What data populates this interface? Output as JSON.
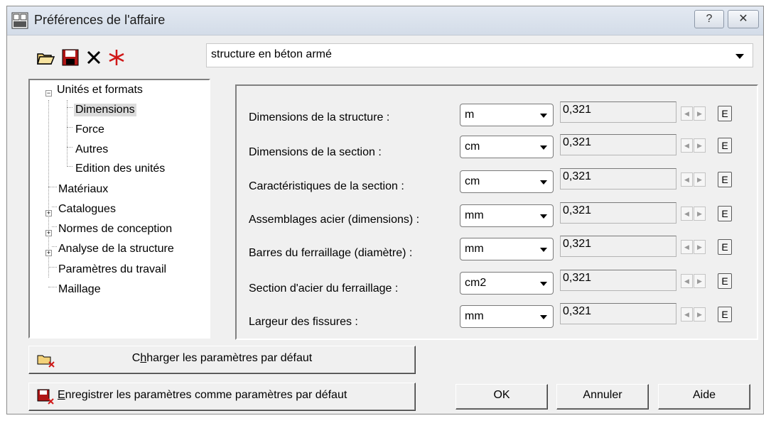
{
  "window": {
    "title": "Préférences de l'affaire",
    "help_label": "?",
    "close_label": "✕"
  },
  "toolbar": {
    "icons": [
      "open-folder-icon",
      "save-disk-icon",
      "delete-x-icon",
      "new-star-icon"
    ]
  },
  "profile_combo": {
    "value": "structure en béton armé"
  },
  "tree": {
    "items": [
      {
        "label": "Unités et formats",
        "level": 0,
        "expander": "−"
      },
      {
        "label": "Dimensions",
        "level": 1,
        "selected": true
      },
      {
        "label": "Force",
        "level": 1
      },
      {
        "label": "Autres",
        "level": 1
      },
      {
        "label": "Edition des unités",
        "level": 1
      },
      {
        "label": "Matériaux",
        "level": 0
      },
      {
        "label": "Catalogues",
        "level": 0,
        "expander": "+"
      },
      {
        "label": "Normes de conception",
        "level": 0,
        "expander": "+"
      },
      {
        "label": "Analyse de la structure",
        "level": 0,
        "expander": "+"
      },
      {
        "label": "Paramètres du travail",
        "level": 0
      },
      {
        "label": "Maillage",
        "level": 0
      }
    ]
  },
  "units": {
    "rows": [
      {
        "label": "Dimensions de la structure :",
        "unit": "m",
        "value": "0,321",
        "e": "E"
      },
      {
        "label": "Dimensions de la section :",
        "unit": "cm",
        "value": "0,321",
        "e": "E"
      },
      {
        "label": "Caractéristiques de la section :",
        "unit": "cm",
        "value": "0,321",
        "e": "E"
      },
      {
        "label": "Assemblages acier (dimensions) :",
        "unit": "mm",
        "value": "0,321",
        "e": "E"
      },
      {
        "label": "Barres du ferraillage (diamètre) :",
        "unit": "mm",
        "value": "0,321",
        "e": "E"
      },
      {
        "label": "Section d'acier du ferraillage :",
        "unit": "cm2",
        "value": "0,321",
        "e": "E"
      },
      {
        "label": "Largeur des fissures :",
        "unit": "mm",
        "value": "0,321",
        "e": "E"
      }
    ]
  },
  "buttons": {
    "load_defaults": {
      "pre": "C",
      "rest": "harger les paramètres par défaut",
      "mnemonic": "h"
    },
    "save_defaults": {
      "pre": "",
      "mnemonic": "E",
      "rest": "nregistrer les paramètres comme paramètres par défaut"
    },
    "ok": "OK",
    "cancel": "Annuler",
    "help": "Aide"
  },
  "colors": {
    "accent_red": "#d01818",
    "title_bg": "#dbe2ec"
  }
}
